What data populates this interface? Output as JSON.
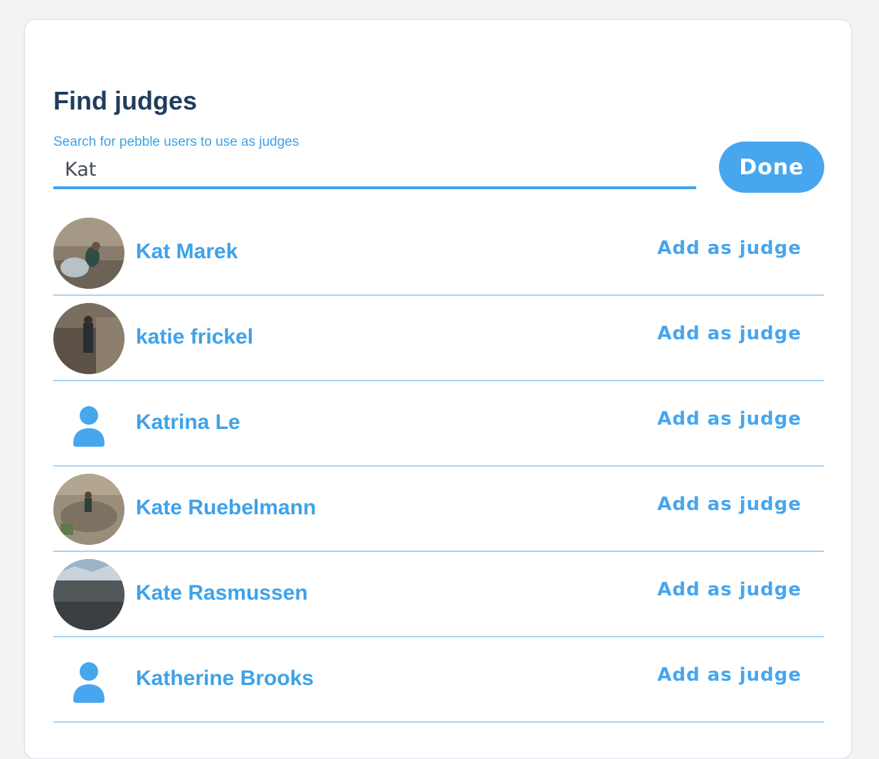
{
  "header": {
    "title": "Find judges"
  },
  "search": {
    "label": "Search for pebble users to use as judges",
    "value": "Kat"
  },
  "done_label": "Done",
  "results": [
    {
      "name": "Kat Marek",
      "avatar": "photo",
      "action_label": "Add as judge"
    },
    {
      "name": "katie frickel",
      "avatar": "photo",
      "action_label": "Add as judge"
    },
    {
      "name": "Katrina Le",
      "avatar": "person-icon",
      "action_label": "Add as judge"
    },
    {
      "name": "Kate Ruebelmann",
      "avatar": "photo",
      "action_label": "Add as judge"
    },
    {
      "name": "Kate Rasmussen",
      "avatar": "photo",
      "action_label": "Add as judge"
    },
    {
      "name": "Katherine Brooks",
      "avatar": "person-icon",
      "action_label": "Add as judge"
    }
  ],
  "colors": {
    "accent": "#46a6ee",
    "title": "#1f3d5c",
    "divider": "#a9d3f3",
    "background": "#f2f3f5"
  }
}
